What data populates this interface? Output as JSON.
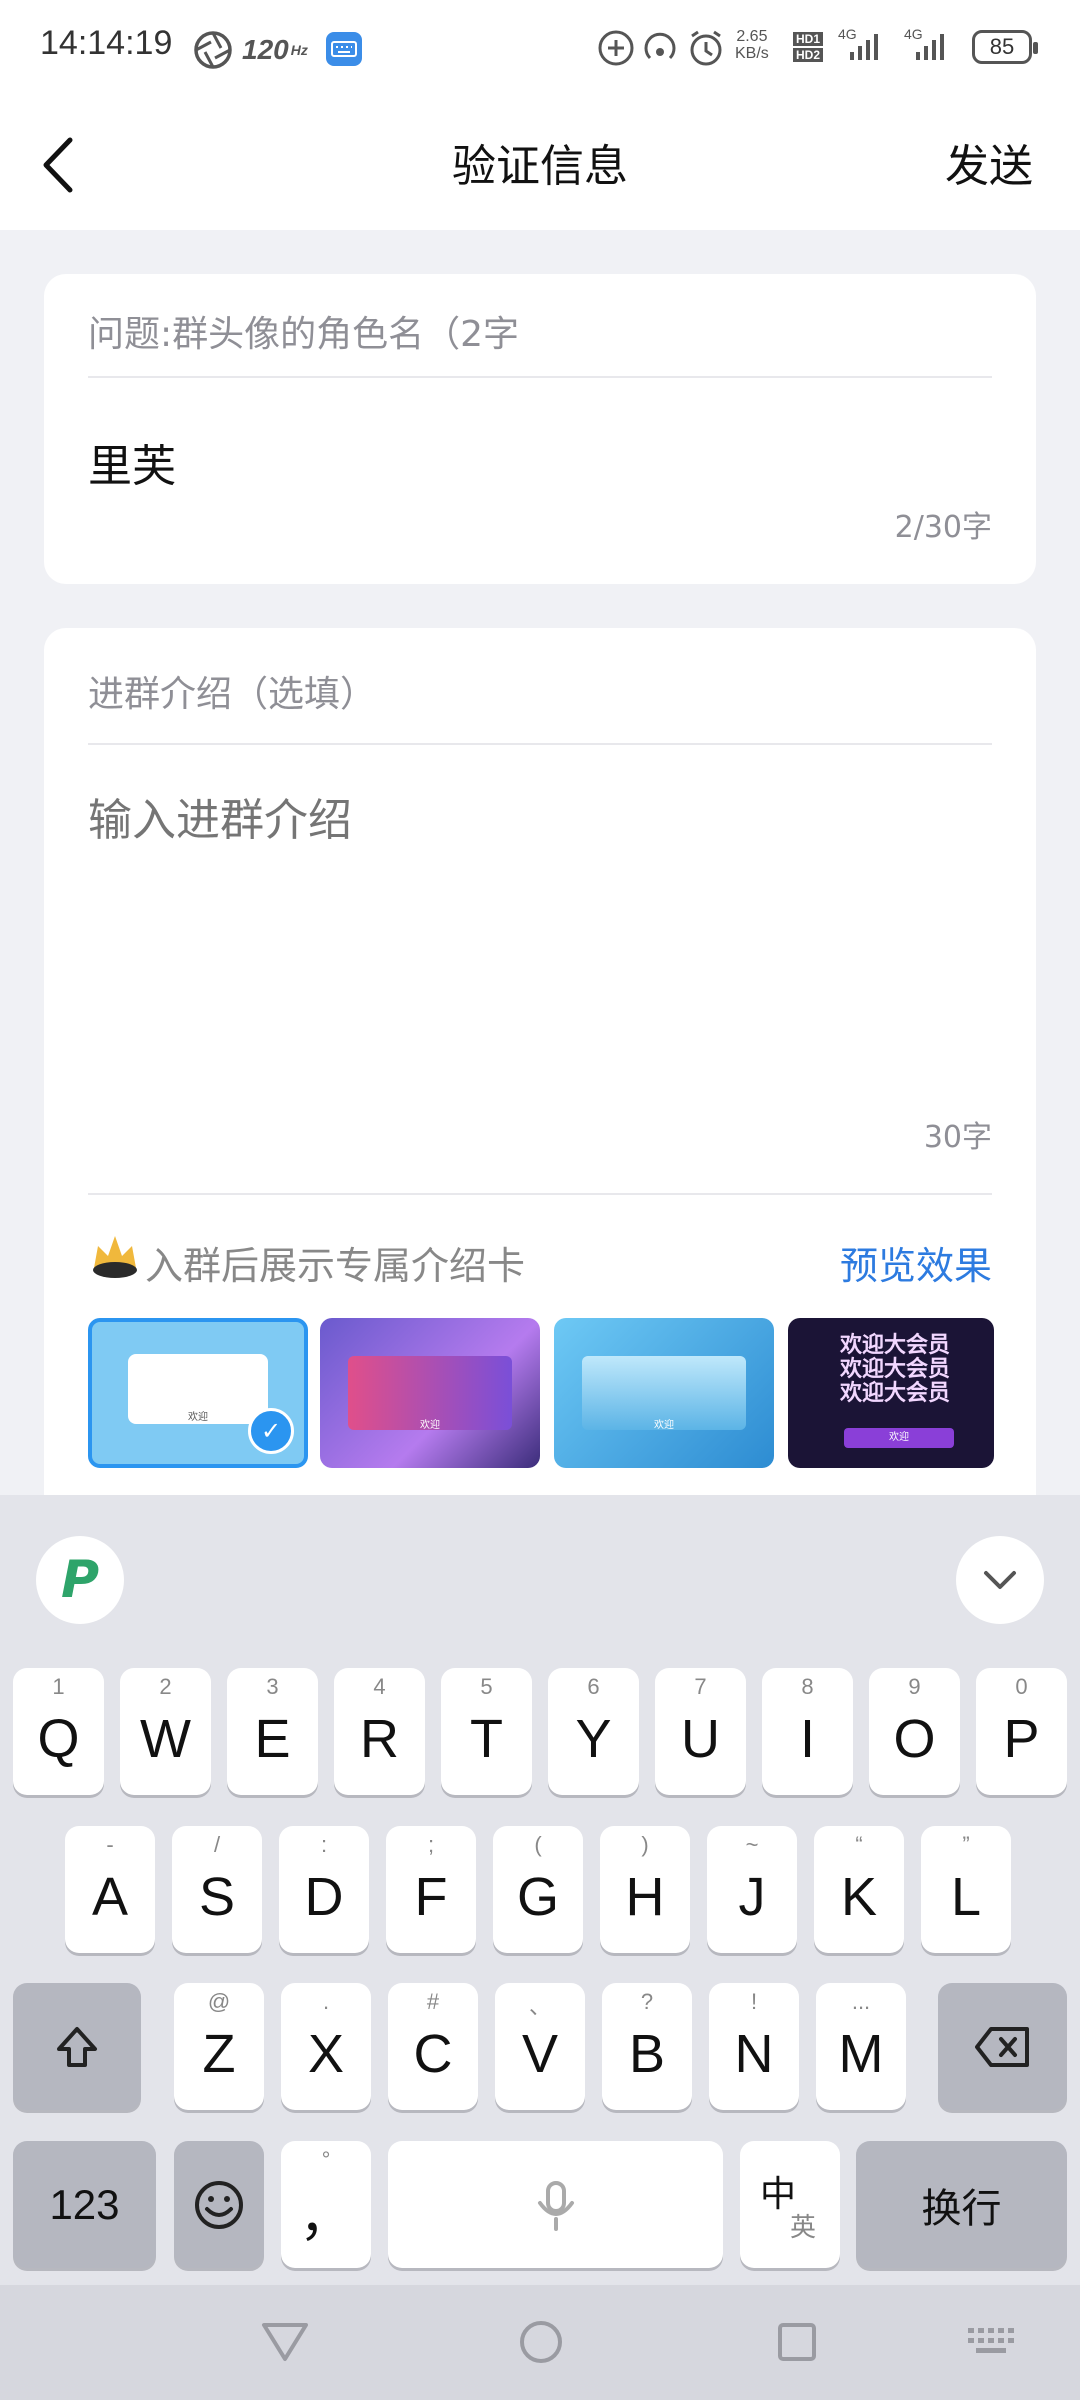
{
  "status_bar": {
    "time": "14:14:19",
    "refresh_rate": "120",
    "net_speed_value": "2.65",
    "net_speed_unit": "KB/s",
    "hd1": "HD1",
    "hd2": "HD2",
    "signal1_label": "4G",
    "signal2_label": "4G",
    "battery": "85"
  },
  "header": {
    "title": "验证信息",
    "send_label": "发送"
  },
  "question_card": {
    "question": "问题:群头像的角色名（2字",
    "answer": "里芙",
    "char_count": "2/30字"
  },
  "intro_card": {
    "label": "进群介绍（选填）",
    "placeholder": "输入进群介绍",
    "char_count": "30字",
    "feature_label": "入群后展示专属介绍卡",
    "preview_label": "预览效果",
    "thumb_caption": "欢迎",
    "thumb4_title": "欢迎大会员",
    "thumb4_caption": "欢迎"
  },
  "keyboard": {
    "row1": [
      {
        "key": "Q",
        "hint": "1"
      },
      {
        "key": "W",
        "hint": "2"
      },
      {
        "key": "E",
        "hint": "3"
      },
      {
        "key": "R",
        "hint": "4"
      },
      {
        "key": "T",
        "hint": "5"
      },
      {
        "key": "Y",
        "hint": "6"
      },
      {
        "key": "U",
        "hint": "7"
      },
      {
        "key": "I",
        "hint": "8"
      },
      {
        "key": "O",
        "hint": "9"
      },
      {
        "key": "P",
        "hint": "0"
      }
    ],
    "row2": [
      {
        "key": "A",
        "hint": "-"
      },
      {
        "key": "S",
        "hint": "/"
      },
      {
        "key": "D",
        "hint": ":"
      },
      {
        "key": "F",
        "hint": ";"
      },
      {
        "key": "G",
        "hint": "("
      },
      {
        "key": "H",
        "hint": ")"
      },
      {
        "key": "J",
        "hint": "~"
      },
      {
        "key": "K",
        "hint": "“"
      },
      {
        "key": "L",
        "hint": "”"
      }
    ],
    "row3": [
      {
        "key": "Z",
        "hint": "@"
      },
      {
        "key": "X",
        "hint": "."
      },
      {
        "key": "C",
        "hint": "#"
      },
      {
        "key": "V",
        "hint": "、"
      },
      {
        "key": "B",
        "hint": "?"
      },
      {
        "key": "N",
        "hint": "!"
      },
      {
        "key": "M",
        "hint": "..."
      }
    ],
    "num_label": "123",
    "punct_label": "，",
    "punct_hint": "°",
    "lang_main": "中",
    "lang_sub": "英",
    "enter_label": "换行"
  }
}
